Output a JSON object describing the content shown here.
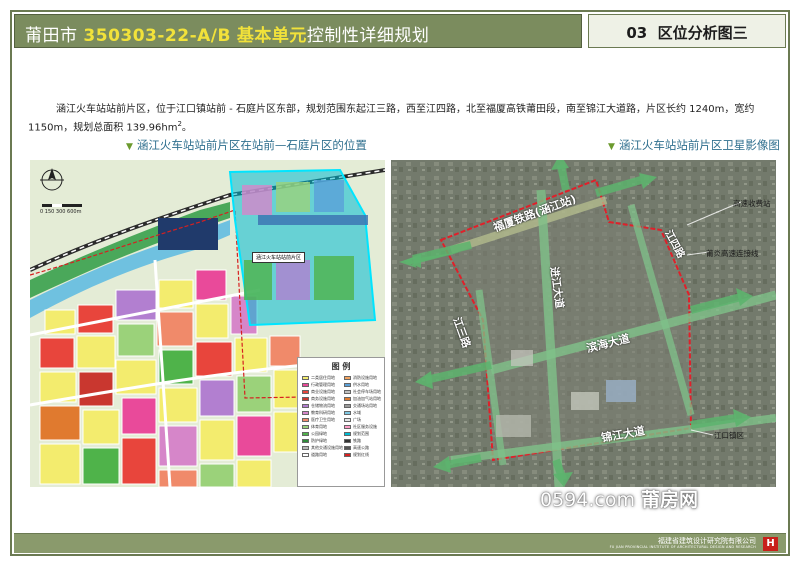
{
  "header": {
    "city": "莆田市",
    "code": "350303-22-A/B",
    "unit": "基本单元",
    "plan": "控制性详细规划",
    "section_no": "03",
    "section_title": "区位分析图三"
  },
  "description": {
    "text": "涵江火车站站前片区，位于江口镇站前 - 石庭片区东部，规划范围东起江三路，西至江四路，北至福厦高铁莆田段，南至锦江大道路，片区长约 1240m，宽约 1150m，规划总面积 139.96hm",
    "sup": "2",
    "end": "。"
  },
  "captions": {
    "left": "涵江火车站站前片区在站前—石庭片区的位置",
    "right": "涵江火车站站前片区卫星影像图"
  },
  "left_map": {
    "highlight_label": "涵江火车站站前片区",
    "legend_title": "图 例",
    "scale_text": "0 150 300 600m",
    "legend_left": [
      {
        "label": "二类居住用地",
        "color": "#f3ec6e"
      },
      {
        "label": "行政管理用地",
        "color": "#e94a9a"
      },
      {
        "label": "商业设施用地",
        "color": "#e8453c"
      },
      {
        "label": "商务设施用地",
        "color": "#c9372f"
      },
      {
        "label": "仓储物流用地",
        "color": "#b27fd0"
      },
      {
        "label": "教育科研用地",
        "color": "#d686c9"
      },
      {
        "label": "医疗卫生用地",
        "color": "#f08a6a"
      },
      {
        "label": "体育用地",
        "color": "#9bd27a"
      },
      {
        "label": "公园绿地",
        "color": "#4fb34a"
      },
      {
        "label": "防护绿地",
        "color": "#2e8b3a"
      },
      {
        "label": "其他交通设施用地",
        "color": "#b8b8b8"
      },
      {
        "label": "道路用地",
        "color": "#ffffff"
      }
    ],
    "legend_right": [
      {
        "label": "消防设施用地",
        "color": "#f4a460"
      },
      {
        "label": "供水用地",
        "color": "#5aa0d8"
      },
      {
        "label": "社会停车场用地",
        "color": "#c0c0c0"
      },
      {
        "label": "加油加气站用地",
        "color": "#e07a2f"
      },
      {
        "label": "交通场站用地",
        "color": "#9a9a9a"
      },
      {
        "label": "水域",
        "color": "#7ec8e3"
      },
      {
        "label": "广场",
        "color": "#e5e5e5"
      },
      {
        "label": "社区服务设施",
        "color": "#ff9ec8"
      },
      {
        "label": "规划范围",
        "color": "#00bcd4"
      },
      {
        "label": "铁路",
        "color": "#333333"
      },
      {
        "label": "高速公路",
        "color": "#555555"
      },
      {
        "label": "规划红线",
        "color": "#d62020"
      }
    ]
  },
  "right_map": {
    "labels": {
      "railway": "福厦铁路(涵江站)",
      "jiangsi": "江四路",
      "jinjiang_n": "进江大道",
      "binhai": "滨海大道",
      "jiangsan": "江三路",
      "jinjiang_s": "锦江大道"
    },
    "external": {
      "toll": "高速收费站",
      "connector": "莆炎高速连接线",
      "town": "江口镇区"
    }
  },
  "watermark": {
    "site": "0594.com",
    "brand": "莆房网"
  },
  "footer": {
    "institute": "福建省建筑设计研究院有限公司",
    "institute_en": "FU JIAN PROVINCIAL INSTITUTE OF ARCHITECTURAL DESIGN AND RESEARCH",
    "logo": "H"
  }
}
